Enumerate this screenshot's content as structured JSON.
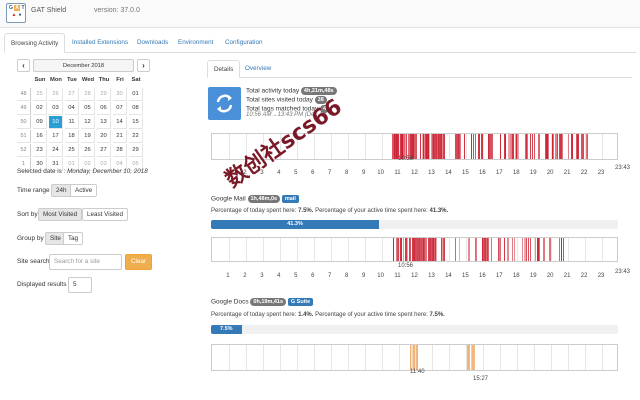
{
  "app": {
    "name": "GAT Shield",
    "version": "version: 37.0.0"
  },
  "tabs": [
    "Browsing Activity",
    "Installed Extensions",
    "Downloads",
    "Environment",
    "Configuration"
  ],
  "calendar": {
    "prev": "‹",
    "next": "›",
    "month_title": "December 2018",
    "day_headers": [
      "Sun",
      "Mon",
      "Tue",
      "Wed",
      "Thu",
      "Fri",
      "Sat"
    ],
    "weeks": [
      {
        "wk": "48",
        "days": [
          "25",
          "26",
          "27",
          "28",
          "29",
          "30",
          "01"
        ]
      },
      {
        "wk": "49",
        "days": [
          "02",
          "03",
          "04",
          "05",
          "06",
          "07",
          "08"
        ]
      },
      {
        "wk": "50",
        "days": [
          "09",
          "10",
          "11",
          "12",
          "13",
          "14",
          "15"
        ]
      },
      {
        "wk": "51",
        "days": [
          "16",
          "17",
          "18",
          "19",
          "20",
          "21",
          "22"
        ]
      },
      {
        "wk": "52",
        "days": [
          "23",
          "24",
          "25",
          "26",
          "27",
          "28",
          "29"
        ]
      },
      {
        "wk": "1",
        "days": [
          "30",
          "31",
          "01",
          "02",
          "03",
          "04",
          "05"
        ]
      }
    ],
    "selected_text": "Selected date is :",
    "selected_value": "Monday, December 10, 2018"
  },
  "filters": {
    "time_range_label": "Time range",
    "time_range_options": [
      "24h",
      "Active"
    ],
    "sort_label": "Sort by",
    "sort_options": [
      "Most Visited",
      "Least Visited"
    ],
    "group_label": "Group by",
    "group_options": [
      "Site",
      "Tag"
    ],
    "search_label": "Site search",
    "search_placeholder": "Search for a site",
    "clear_label": "Clear",
    "results_label": "Displayed results",
    "results_value": "5"
  },
  "pane_tabs": [
    "Details",
    "Overview"
  ],
  "summary": {
    "activity_label": "Total activity today",
    "activity_value": "4h,21m,48s",
    "sites_label": "Total sites visited today",
    "sites_value": "38",
    "tags_label": "Total tags matched today",
    "tags_value": "4",
    "time_range": "10:56 AM→13:43 PM (Dec 10"
  },
  "hours": [
    "1",
    "2",
    "3",
    "4",
    "5",
    "6",
    "7",
    "8",
    "9",
    "10",
    "11",
    "12",
    "13",
    "14",
    "15",
    "16",
    "17",
    "18",
    "19",
    "20",
    "21",
    "22",
    "23"
  ],
  "overall_timeline": {
    "start_annot": "10:56",
    "end_annot": "23:43"
  },
  "sites": [
    {
      "name": "Google Mail",
      "duration": "1h,48m,0s",
      "tag": "mail",
      "today_label": "Percentage of today spent here:",
      "today_value": "7.5%.",
      "active_label": "Percentage of your active time spent here:",
      "active_value": "41.3%.",
      "progress_label": "41.3%",
      "progress": 41.3,
      "start_annot": "10:56",
      "end_annot": "23:43"
    },
    {
      "name": "Google Docs",
      "duration": "0h,19m,41s",
      "tag": "G Suite",
      "today_label": "Percentage of today spent here:",
      "today_value": "1.4%.",
      "active_label": "Percentage of your active time spent here:",
      "active_value": "7.5%.",
      "progress_label": "7.5%",
      "progress": 7.5,
      "start_annot": "11:40",
      "end_annot": "15:27"
    }
  ],
  "watermark": "数创社scs66",
  "colors": {
    "accent": "#337ab7",
    "selected_day": "#2a9fd6",
    "clear_button": "#f0ad4e",
    "activity_mark": "#cc2233",
    "docs_mark": "#f0b070",
    "sync_box": "#4a90d9",
    "watermark": "#7a1a28"
  }
}
